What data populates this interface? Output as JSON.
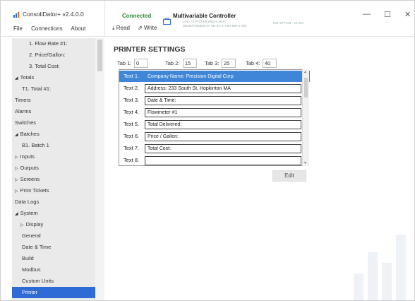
{
  "app": {
    "title": "ConsoliDator+ v2.4.0.0"
  },
  "menu": {
    "file": "File",
    "connections": "Connections",
    "about": "About"
  },
  "connection": {
    "status": "Connected",
    "read_label": "Read",
    "write_label": "Write",
    "device_name": "Multivariable Controller",
    "device_line1": "SVD-727P-G6H5-B8GH-JKH3",
    "device_line2": "(Model PD6000-X7-VD-GA-1-HST-MFI-1-TB)",
    "firmware": "FW: SFT144 - v2.404",
    "status_color": "#2e8b3a"
  },
  "window_controls": {
    "minimize": "—",
    "maximize": "☐",
    "close": "✕"
  },
  "sidebar": {
    "items": [
      {
        "label": "1. Flow Rate #1:",
        "arrow": ""
      },
      {
        "label": "2. Price/Gallon:",
        "arrow": ""
      },
      {
        "label": "3. Total Cost:",
        "arrow": ""
      },
      {
        "label": "Totals",
        "arrow": "◢"
      },
      {
        "label": "T1. Total #1:",
        "arrow": ""
      },
      {
        "label": "Timers",
        "arrow": ""
      },
      {
        "label": "Alarms",
        "arrow": ""
      },
      {
        "label": "Switches",
        "arrow": ""
      },
      {
        "label": "Batches",
        "arrow": "◢"
      },
      {
        "label": "B1. Batch 1",
        "arrow": ""
      },
      {
        "label": "Inputs",
        "arrow": "▷"
      },
      {
        "label": "Outputs",
        "arrow": "▷"
      },
      {
        "label": "Screens",
        "arrow": "▷"
      },
      {
        "label": "Print Tickets",
        "arrow": "▷"
      },
      {
        "label": "Data Logs",
        "arrow": ""
      },
      {
        "label": "System",
        "arrow": "◢"
      },
      {
        "label": "Display",
        "arrow": "▷"
      },
      {
        "label": "General",
        "arrow": ""
      },
      {
        "label": "Date & Time",
        "arrow": ""
      },
      {
        "label": "Build",
        "arrow": ""
      },
      {
        "label": "Modbus",
        "arrow": ""
      },
      {
        "label": "Custom Units",
        "arrow": ""
      },
      {
        "label": "Printer",
        "arrow": ""
      }
    ],
    "selected": "Printer",
    "selected_color": "#2f6bd6"
  },
  "printer": {
    "title": "PRINTER SETTINGS",
    "tabs": [
      {
        "label": "Tab 1:",
        "value": "0"
      },
      {
        "label": "Tab 2:",
        "value": "15"
      },
      {
        "label": "Tab 3:",
        "value": "25"
      },
      {
        "label": "Tab 4:",
        "value": "40"
      }
    ],
    "rows": [
      {
        "label": "Text 1.",
        "value": "Company Name: Precision Digital Corp"
      },
      {
        "label": "Text 2.",
        "value": "Address: 233 South St, Hopkinton MA"
      },
      {
        "label": "Text 3.",
        "value": "Date & Time:"
      },
      {
        "label": "Text 4.",
        "value": "Flowmeter #1"
      },
      {
        "label": "Text 5.",
        "value": "Total Delivered:"
      },
      {
        "label": "Text 6.",
        "value": "Price / Gallon:"
      },
      {
        "label": "Text 7.",
        "value": "Total Cost:"
      },
      {
        "label": "Text 8.",
        "value": ""
      }
    ],
    "selected_row": "Text 1.",
    "selected_color": "#3f86d8",
    "edit_label": "Edit"
  }
}
